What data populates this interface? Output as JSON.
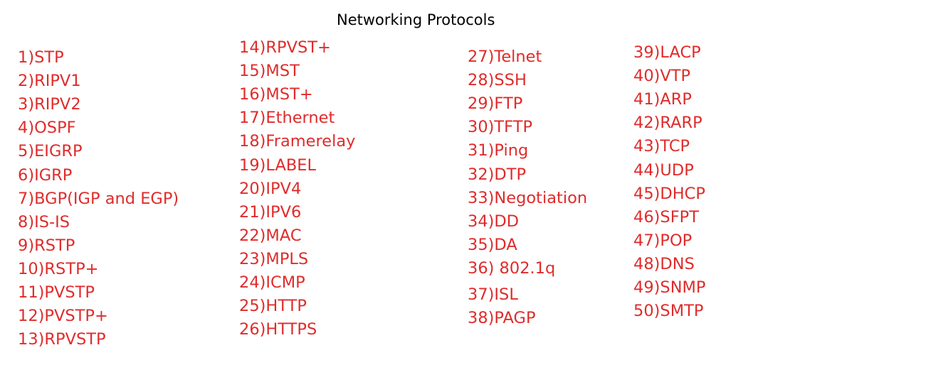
{
  "title": "Networking Protocols",
  "colors": {
    "item_text": "#e02b2b",
    "title_text": "#000000",
    "background": "#ffffff"
  },
  "columns": [
    {
      "items": [
        "1)STP",
        "2)RIPV1",
        "3)RIPV2",
        "4)OSPF",
        "5)EIGRP",
        "6)IGRP",
        "7)BGP(IGP and EGP)",
        "8)IS-IS",
        "9)RSTP",
        "10)RSTP+",
        "11)PVSTP",
        "12)PVSTP+",
        "13)RPVSTP"
      ]
    },
    {
      "items": [
        "14)RPVST+",
        "15)MST",
        "16)MST+",
        "17)Ethernet",
        "18)Framerelay",
        "19)LABEL",
        "20)IPV4",
        "21)IPV6",
        "22)MAC",
        "23)MPLS",
        "24)ICMP",
        "25)HTTP",
        "26)HTTPS"
      ]
    },
    {
      "items": [
        "27)Telnet",
        "28)SSH",
        "29)FTP",
        "30)TFTP",
        "31)Ping",
        "32)DTP",
        "33)Negotiation",
        "34)DD",
        "35)DA",
        "36) 802.1q",
        "37)ISL",
        "38)PAGP"
      ]
    },
    {
      "items": [
        "39)LACP",
        "40)VTP",
        "41)ARP",
        "42)RARP",
        "43)TCP",
        "44)UDP",
        "45)DHCP",
        "46)SFPT",
        "47)POP",
        "48)DNS",
        "49)SNMP",
        "50)SMTP"
      ]
    }
  ]
}
